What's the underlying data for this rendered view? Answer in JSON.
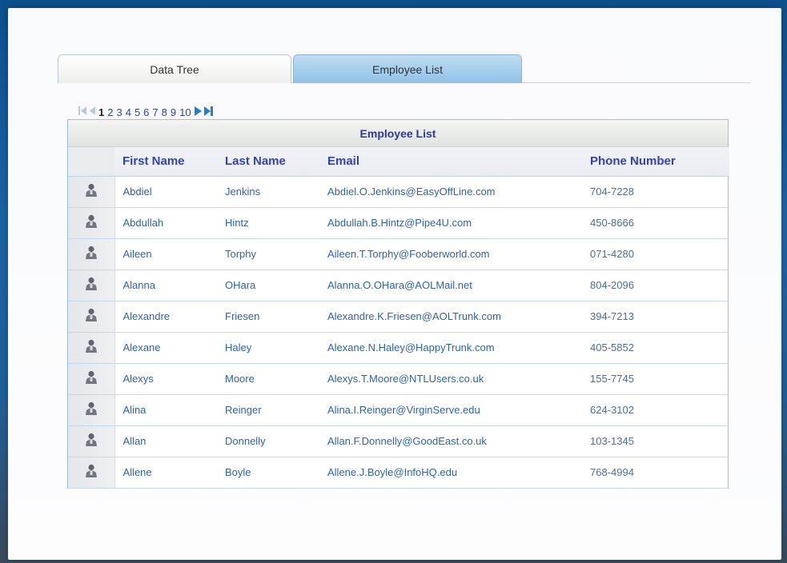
{
  "tabs": [
    {
      "label": "Data Tree",
      "active": false
    },
    {
      "label": "Employee List",
      "active": true
    }
  ],
  "pager": {
    "first_icon": "first-page-icon",
    "prev_icon": "previous-page-icon",
    "next_icon": "next-page-icon",
    "last_icon": "last-page-icon",
    "pages": [
      "1",
      "2",
      "3",
      "4",
      "5",
      "6",
      "7",
      "8",
      "9",
      "10"
    ],
    "current_page": "1"
  },
  "grid": {
    "caption": "Employee List",
    "columns": [
      "First Name",
      "Last Name",
      "Email",
      "Phone Number"
    ],
    "row_icon": "person-icon",
    "rows": [
      {
        "first": "Abdiel",
        "last": "Jenkins",
        "email": "Abdiel.O.Jenkins@EasyOffLine.com",
        "phone": "704-7228"
      },
      {
        "first": "Abdullah",
        "last": "Hintz",
        "email": "Abdullah.B.Hintz@Pipe4U.com",
        "phone": "450-8666"
      },
      {
        "first": "Aileen",
        "last": "Torphy",
        "email": "Aileen.T.Torphy@Fooberworld.com",
        "phone": "071-4280"
      },
      {
        "first": "Alanna",
        "last": "OHara",
        "email": "Alanna.O.OHara@AOLMail.net",
        "phone": "804-2096"
      },
      {
        "first": "Alexandre",
        "last": "Friesen",
        "email": "Alexandre.K.Friesen@AOLTrunk.com",
        "phone": "394-7213"
      },
      {
        "first": "Alexane",
        "last": "Haley",
        "email": "Alexane.N.Haley@HappyTrunk.com",
        "phone": "405-5852"
      },
      {
        "first": "Alexys",
        "last": "Moore",
        "email": "Alexys.T.Moore@NTLUsers.co.uk",
        "phone": "155-7745"
      },
      {
        "first": "Alina",
        "last": "Reinger",
        "email": "Alina.I.Reinger@VirginServe.edu",
        "phone": "624-3102"
      },
      {
        "first": "Allan",
        "last": "Donnelly",
        "email": "Allan.F.Donnelly@GoodEast.co.uk",
        "phone": "103-1345"
      },
      {
        "first": "Allene",
        "last": "Boyle",
        "email": "Allene.J.Boyle@InfoHQ.edu",
        "phone": "768-4994"
      }
    ]
  },
  "colors": {
    "header_text": "#3343b5",
    "cell_text": "#2d64b0",
    "active_tab": "#90c2e8",
    "grid_border": "#9fc0e0"
  }
}
